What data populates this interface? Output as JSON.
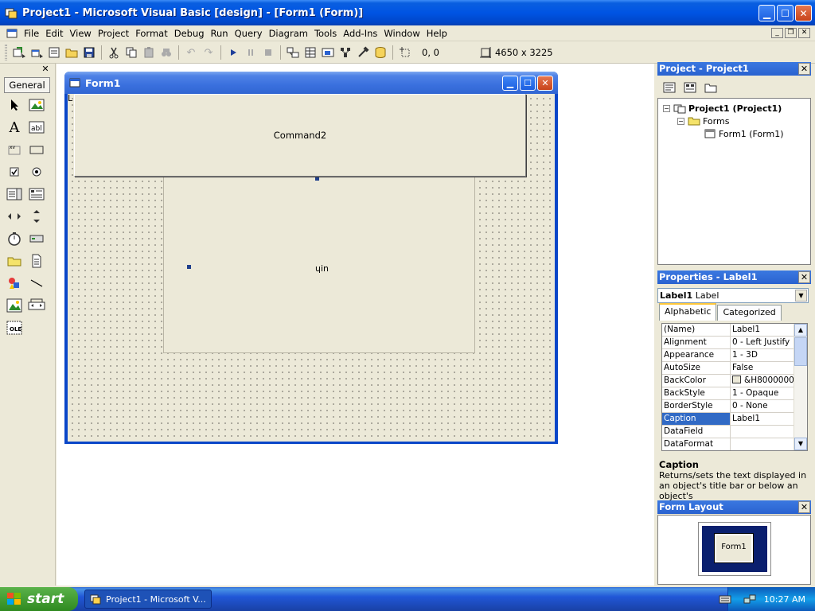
{
  "window": {
    "title": "Project1 - Microsoft Visual Basic [design] - [Form1 (Form)]"
  },
  "menu": [
    "File",
    "Edit",
    "View",
    "Project",
    "Format",
    "Debug",
    "Run",
    "Query",
    "Diagram",
    "Tools",
    "Add-Ins",
    "Window",
    "Help"
  ],
  "toolbar": {
    "position": "0, 0",
    "size": "4650 x 3225"
  },
  "toolbox": {
    "tab": "General"
  },
  "form": {
    "title": "Form1",
    "command_caption": "Command2",
    "label_caption": "Label1",
    "label_corner": "L"
  },
  "project": {
    "title": "Project - Project1",
    "root": "Project1 (Project1)",
    "folder": "Forms",
    "form": "Form1 (Form1)"
  },
  "properties": {
    "title": "Properties - Label1",
    "object_name": "Label1",
    "object_type": "Label",
    "tabs": [
      "Alphabetic",
      "Categorized"
    ],
    "rows": [
      {
        "name": "(Name)",
        "value": "Label1"
      },
      {
        "name": "Alignment",
        "value": "0 - Left Justify"
      },
      {
        "name": "Appearance",
        "value": "1 - 3D"
      },
      {
        "name": "AutoSize",
        "value": "False"
      },
      {
        "name": "BackColor",
        "value": "&H8000000F"
      },
      {
        "name": "BackStyle",
        "value": "1 - Opaque"
      },
      {
        "name": "BorderStyle",
        "value": "0 - None"
      },
      {
        "name": "Caption",
        "value": "Label1"
      },
      {
        "name": "DataField",
        "value": ""
      },
      {
        "name": "DataFormat",
        "value": ""
      }
    ],
    "desc_title": "Caption",
    "desc_text": "Returns/sets the text displayed in an object's title bar or below an object's"
  },
  "form_layout": {
    "title": "Form Layout",
    "preview_label": "Form1"
  },
  "taskbar": {
    "start": "start",
    "task": "Project1 - Microsoft V...",
    "clock": "10:27 AM"
  },
  "colors": {
    "xp_blue": "#0054e3",
    "selection": "#316ac5",
    "start_green": "#3c9a2c"
  }
}
